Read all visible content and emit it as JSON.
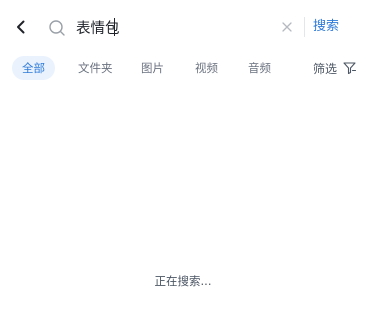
{
  "search": {
    "query": "表情包",
    "submit_label": "搜索"
  },
  "tabs": [
    {
      "label": "全部",
      "active": true
    },
    {
      "label": "文件夹",
      "active": false
    },
    {
      "label": "图片",
      "active": false
    },
    {
      "label": "视频",
      "active": false
    },
    {
      "label": "音频",
      "active": false
    }
  ],
  "filter": {
    "label": "筛选"
  },
  "status": {
    "text": "正在搜索..."
  },
  "colors": {
    "accent": "#2e7bd9",
    "active_tab_bg": "#eaf2fd",
    "text_muted": "#6b7280"
  },
  "icons": {
    "back": "chevron-left-icon",
    "search": "search-icon",
    "clear": "close-icon",
    "filter": "filter-icon"
  }
}
